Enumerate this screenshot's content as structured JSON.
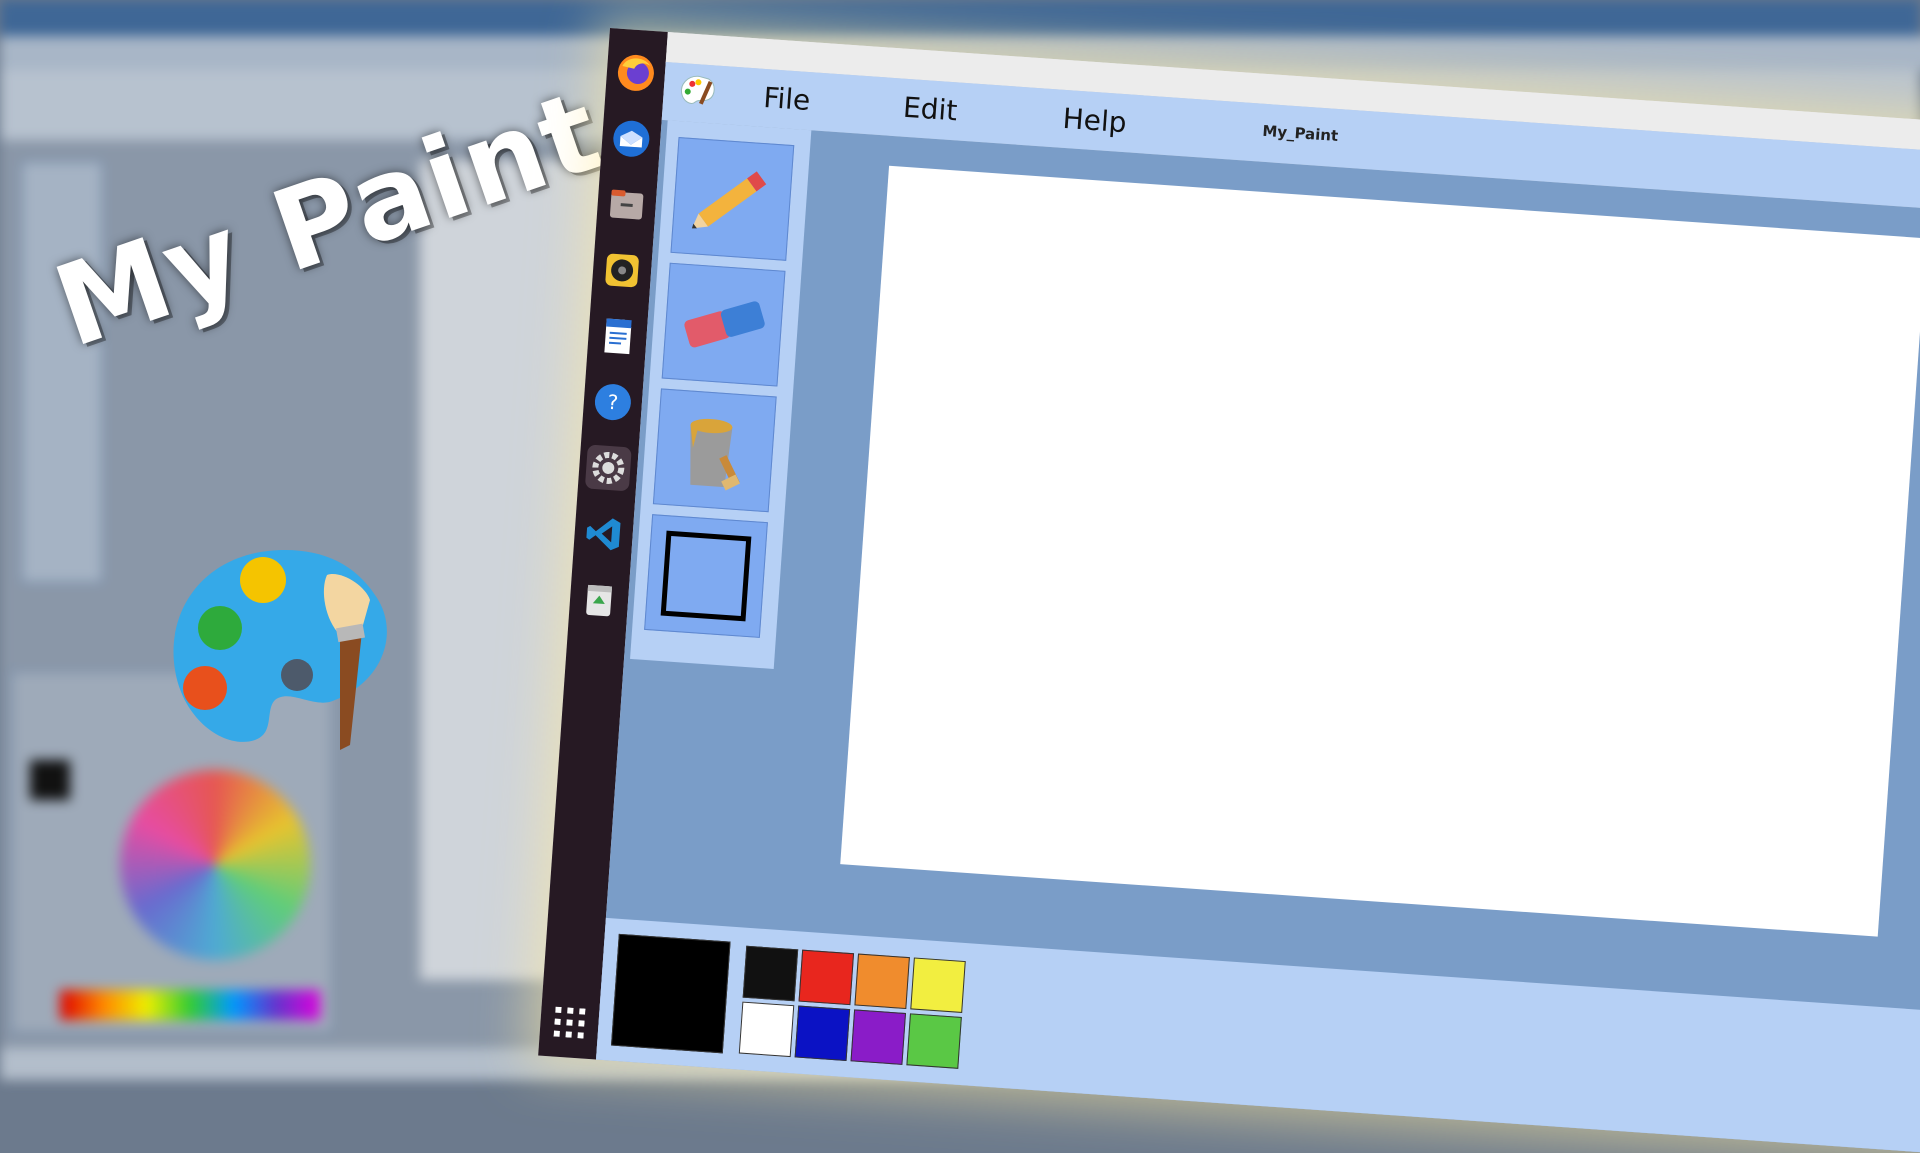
{
  "hero": {
    "title": "My Paint"
  },
  "window": {
    "title": "My_Paint",
    "menu": [
      {
        "label": "File"
      },
      {
        "label": "Edit"
      },
      {
        "label": "Help"
      }
    ]
  },
  "dock": {
    "icons": [
      "firefox-icon",
      "thunderbird-icon",
      "files-icon",
      "rhythmbox-icon",
      "writer-icon",
      "help-icon",
      "settings-icon",
      "vscode-icon",
      "trash-icon"
    ],
    "apps_grid": "show-applications-icon"
  },
  "tools": [
    {
      "name": "pencil"
    },
    {
      "name": "eraser"
    },
    {
      "name": "paint-bucket"
    },
    {
      "name": "rectangle"
    }
  ],
  "palette": {
    "current": "#000000",
    "colors": [
      "#111111",
      "#e8261e",
      "#f08c2d",
      "#f2ee40",
      "#ffffff",
      "#0b12c4",
      "#8a1cc8",
      "#5ac845"
    ]
  }
}
